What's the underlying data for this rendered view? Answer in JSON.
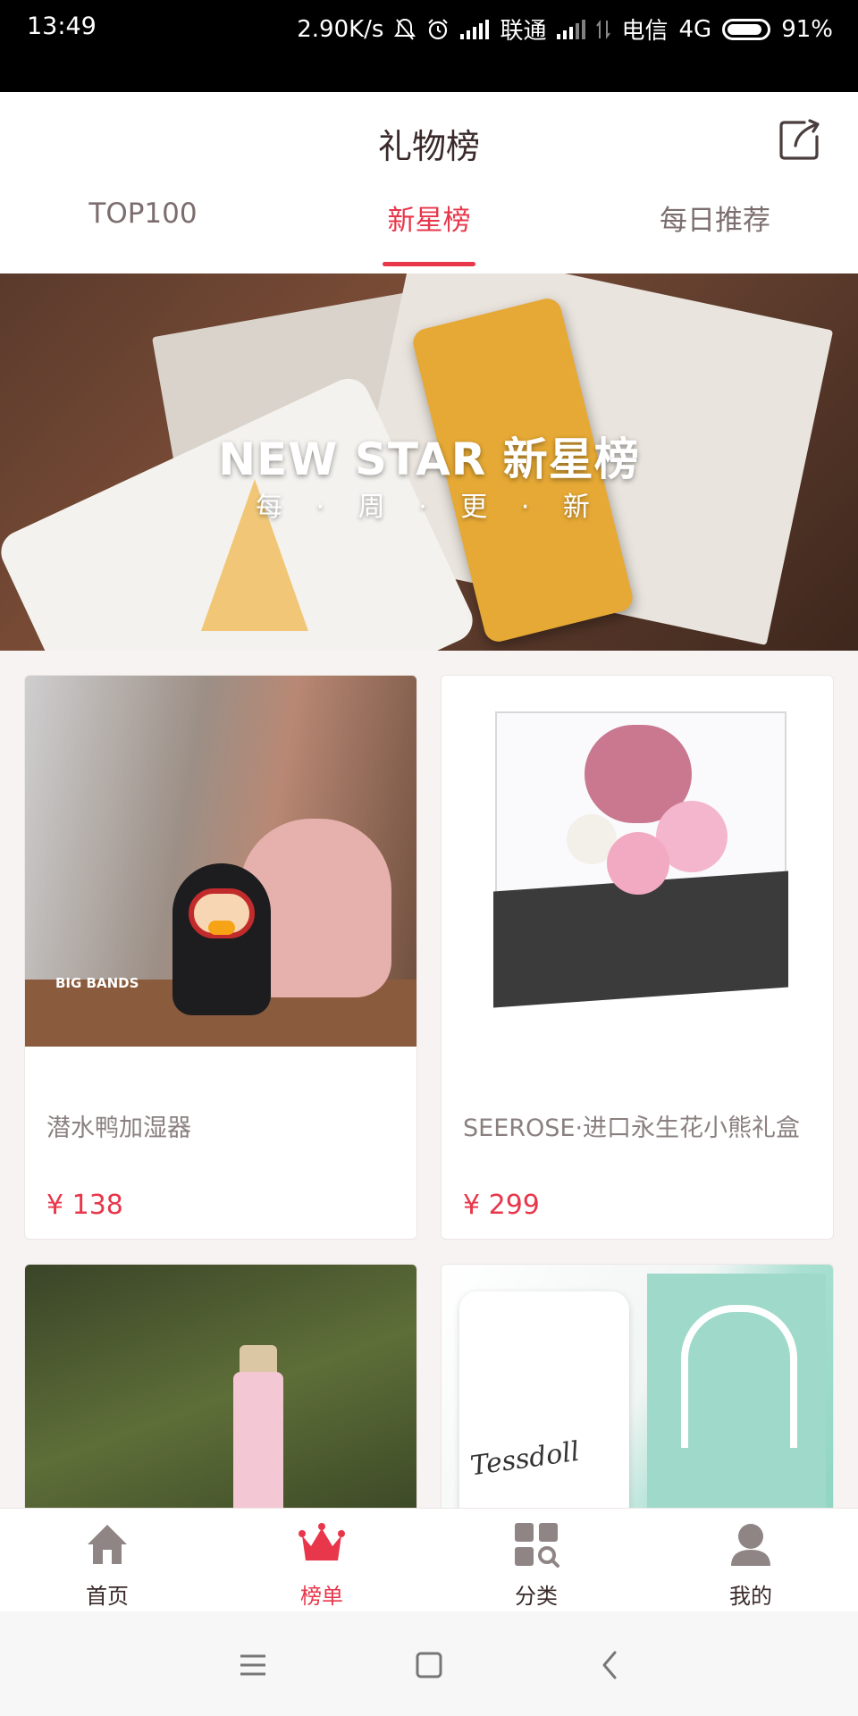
{
  "status_bar": {
    "time": "13:49",
    "net_speed": "2.90K/s",
    "carrier1": "联通",
    "carrier2": "电信",
    "network": "4G",
    "battery": "91%",
    "battery_level": 0.91
  },
  "header": {
    "title": "礼物榜",
    "share_icon": "share-icon"
  },
  "tabs": [
    {
      "label": "TOP100",
      "active": false
    },
    {
      "label": "新星榜",
      "active": true
    },
    {
      "label": "每日推荐",
      "active": false
    }
  ],
  "banner": {
    "title": "NEW STAR  新星榜",
    "subtitle": "每 · 周 · 更 · 新"
  },
  "products": [
    {
      "name": "潜水鸭加湿器",
      "price": "¥ 138",
      "image_brand": "BIG BANDS"
    },
    {
      "name": "SEEROSE·进口永生花小熊礼盒",
      "price": "¥ 299"
    },
    {
      "name": "",
      "price": ""
    },
    {
      "name": "",
      "price": "",
      "image_brand": "Tessdoll"
    }
  ],
  "bottom_nav": [
    {
      "label": "首页",
      "icon": "home-icon",
      "active": false
    },
    {
      "label": "榜单",
      "icon": "crown-icon",
      "active": true
    },
    {
      "label": "分类",
      "icon": "category-search-icon",
      "active": false
    },
    {
      "label": "我的",
      "icon": "profile-icon",
      "active": false
    }
  ],
  "colors": {
    "accent": "#e8364a",
    "text_dark": "#3a2a2a",
    "text_muted": "#8b8080",
    "icon_gray": "#8f8585"
  }
}
